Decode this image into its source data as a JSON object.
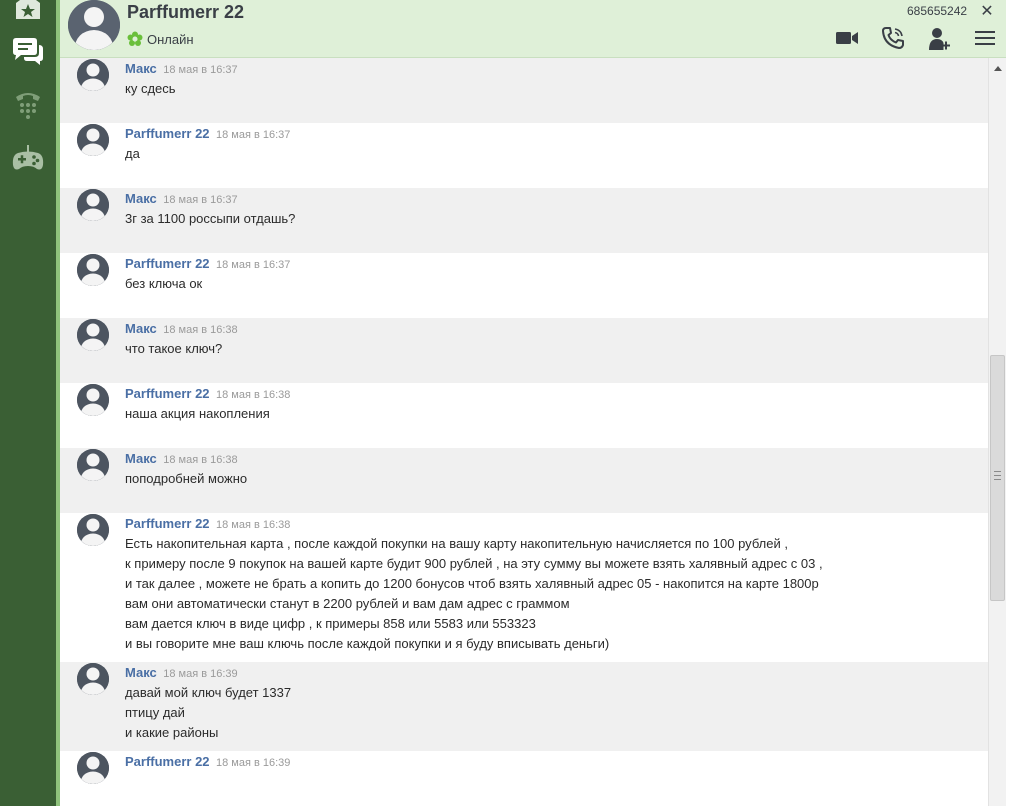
{
  "header": {
    "contact_name": "Parffumerr 22",
    "status_text": "Онлайн",
    "user_id": "685655242",
    "close_label": "✕"
  },
  "sidebar": {
    "items": [
      {
        "icon": "star-house-icon"
      },
      {
        "icon": "chat-bubbles-icon",
        "active": true
      },
      {
        "icon": "phone-dialpad-icon"
      },
      {
        "icon": "gamepad-icon"
      }
    ]
  },
  "toolbar": {
    "icons": [
      "video-call-icon",
      "voice-call-icon",
      "add-contact-icon",
      "menu-icon"
    ]
  },
  "messages": [
    {
      "author": "Макс",
      "time": "18 мая в 16:37",
      "lines": [
        "ку сдесь"
      ]
    },
    {
      "author": "Parffumerr 22",
      "time": "18 мая в 16:37",
      "lines": [
        "да"
      ]
    },
    {
      "author": "Макс",
      "time": "18 мая в 16:37",
      "lines": [
        "3г за 1100 россыпи отдашь?"
      ]
    },
    {
      "author": "Parffumerr 22",
      "time": "18 мая в 16:37",
      "lines": [
        "без ключа ок"
      ]
    },
    {
      "author": "Макс",
      "time": "18 мая в 16:38",
      "lines": [
        "что такое ключ?"
      ]
    },
    {
      "author": "Parffumerr 22",
      "time": "18 мая в 16:38",
      "lines": [
        "наша акция накопления"
      ]
    },
    {
      "author": "Макс",
      "time": "18 мая в 16:38",
      "lines": [
        "поподробней можно"
      ]
    },
    {
      "author": "Parffumerr 22",
      "time": "18 мая в 16:38",
      "lines": [
        "Есть накопительная карта , после каждой покупки на вашу карту накопительную начисляется по 100 рублей ,",
        "к примеру после 9 покупок на вашей карте будит 900 рублей , на эту сумму вы можете взять халявный адрес с 03 ,",
        "и так далее , можете не брать а копить до 1200 бонусов чтоб взять халявный адрес 05 - накопится на карте 1800р",
        "вам они автоматически станут в 2200 рублей и вам дам адрес с граммом",
        "вам дается ключ в виде цифр , к примеры 858 или 5583 или 553323",
        "и вы говорите мне ваш ключь после каждой покупки и я буду вписывать деньги)"
      ]
    },
    {
      "author": "Макс",
      "time": "18 мая в 16:39",
      "lines": [
        "давай мой ключ будет 1337",
        "птицу дай",
        "и какие районы"
      ]
    },
    {
      "author": "Parffumerr 22",
      "time": "18 мая в 16:39",
      "lines": []
    }
  ],
  "colors": {
    "rail": "#3a5f34",
    "rail_edge": "#8fc27c",
    "header_bg": "#dff0d8",
    "author": "#4a6fa5",
    "row_alt": "#f0f0f0",
    "status_icon": "#6abf3b"
  }
}
